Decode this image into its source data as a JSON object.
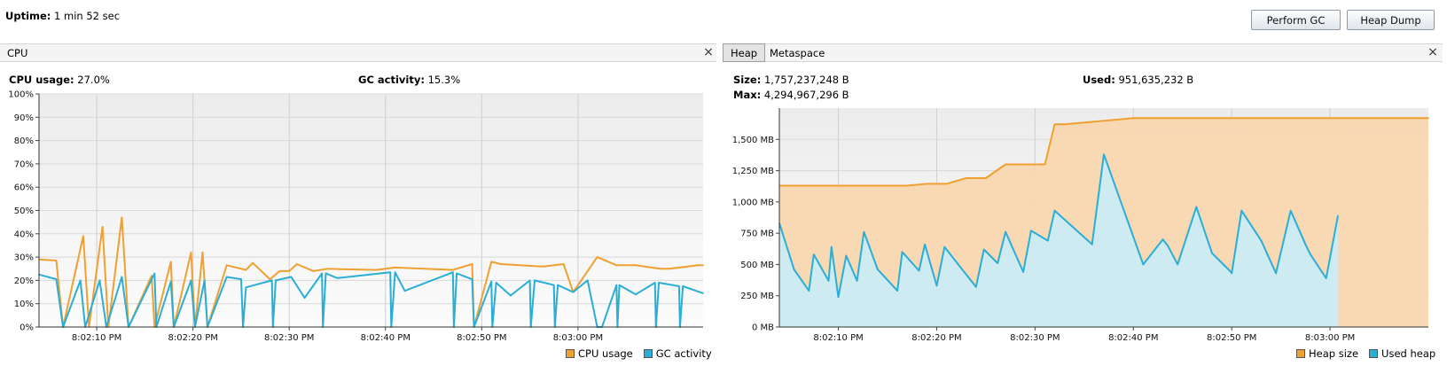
{
  "header": {
    "uptime_label": "Uptime:",
    "uptime_value": "1 min 52 sec",
    "perform_gc_label": "Perform GC",
    "heap_dump_label": "Heap Dump"
  },
  "cpu_panel": {
    "tab_label": "CPU",
    "close_glyph": "×",
    "cpu_usage_label": "CPU usage:",
    "cpu_usage_value": "27.0%",
    "gc_activity_label": "GC activity:",
    "gc_activity_value": "15.3%",
    "legend": [
      "CPU usage",
      "GC activity"
    ]
  },
  "heap_panel": {
    "tabs": [
      "Heap",
      "Metaspace"
    ],
    "active_tab": "Heap",
    "close_glyph": "×",
    "size_label": "Size:",
    "size_value": "1,757,237,248 B",
    "used_label": "Used:",
    "used_value": "951,635,232 B",
    "max_label": "Max:",
    "max_value": "4,294,967,296 B",
    "legend": [
      "Heap size",
      "Used heap"
    ]
  },
  "colors": {
    "orange": "#f0a030",
    "blue": "#2aaed6",
    "heap_fill": "#f8d7b0",
    "used_fill": "#c9ecf8"
  },
  "chart_data": [
    {
      "type": "line",
      "name": "cpu",
      "ylim": [
        0,
        100
      ],
      "yticks": [
        "0%",
        "10%",
        "20%",
        "30%",
        "40%",
        "50%",
        "60%",
        "70%",
        "80%",
        "90%",
        "100%"
      ],
      "xlim": [
        4,
        115
      ],
      "xticks": [
        {
          "t": 10,
          "label": "8:02:10 PM"
        },
        {
          "t": 20,
          "label": "8:02:20 PM"
        },
        {
          "t": 30,
          "label": "8:02:30 PM"
        },
        {
          "t": 40,
          "label": "8:02:40 PM"
        },
        {
          "t": 50,
          "label": "8:02:50 PM"
        },
        {
          "t": 60,
          "label": "8:03:00 PM"
        }
      ],
      "grid": true,
      "legend_position": "bottom-right",
      "series": [
        {
          "name": "CPU usage",
          "color": "#f0a030",
          "points": [
            [
              4,
              29
            ],
            [
              5.8,
              28.5
            ],
            [
              6.5,
              0
            ],
            [
              8.6,
              39
            ],
            [
              9.2,
              0
            ],
            [
              10.6,
              43
            ],
            [
              11.2,
              0
            ],
            [
              12.6,
              47
            ],
            [
              13.3,
              0
            ],
            [
              15.7,
              22
            ],
            [
              16,
              0
            ],
            [
              17.7,
              28
            ],
            [
              18,
              0
            ],
            [
              19.8,
              32
            ],
            [
              20.2,
              0
            ],
            [
              21,
              32
            ],
            [
              21.5,
              0
            ],
            [
              23.5,
              26.5
            ],
            [
              25.5,
              24.5
            ],
            [
              26.2,
              27.5
            ],
            [
              28,
              20.5
            ],
            [
              29,
              24
            ],
            [
              30,
              24
            ],
            [
              30.8,
              27
            ],
            [
              32.5,
              24
            ],
            [
              34,
              25
            ],
            [
              39,
              24.5
            ],
            [
              41,
              25.5
            ],
            [
              47,
              24.5
            ],
            [
              49,
              27
            ],
            [
              49.2,
              0
            ],
            [
              51,
              28
            ],
            [
              52,
              27
            ],
            [
              56,
              26
            ],
            [
              56.5,
              26
            ],
            [
              58.5,
              27
            ],
            [
              59.5,
              15
            ],
            [
              62,
              30
            ],
            [
              64,
              26.5
            ],
            [
              66,
              26.5
            ],
            [
              68.5,
              25
            ],
            [
              69.5,
              25
            ],
            [
              72.5,
              26.5
            ],
            [
              73,
              26.5
            ]
          ]
        },
        {
          "name": "GC activity",
          "color": "#2aaed6",
          "points": [
            [
              4,
              22.5
            ],
            [
              5.8,
              20.5
            ],
            [
              6.5,
              0
            ],
            [
              8.3,
              20
            ],
            [
              8.8,
              0
            ],
            [
              10.3,
              20
            ],
            [
              11,
              0
            ],
            [
              12.6,
              21.5
            ],
            [
              13.3,
              0
            ],
            [
              16,
              23
            ],
            [
              16.2,
              0
            ],
            [
              17.7,
              19.5
            ],
            [
              18,
              0
            ],
            [
              19.8,
              20
            ],
            [
              20.2,
              0
            ],
            [
              21.2,
              20
            ],
            [
              21.5,
              0
            ],
            [
              23.5,
              21.5
            ],
            [
              25,
              20.5
            ],
            [
              25.2,
              0
            ],
            [
              25.5,
              17
            ],
            [
              28.2,
              20
            ],
            [
              28.3,
              0
            ],
            [
              28.6,
              20
            ],
            [
              30.2,
              21.5
            ],
            [
              31.6,
              12.5
            ],
            [
              33.4,
              23
            ],
            [
              33.5,
              0
            ],
            [
              33.8,
              23
            ],
            [
              35,
              21
            ],
            [
              40.5,
              23.5
            ],
            [
              40.6,
              0
            ],
            [
              41,
              23.5
            ],
            [
              42,
              15.5
            ],
            [
              47,
              23.5
            ],
            [
              47.1,
              0
            ],
            [
              47.4,
              23
            ],
            [
              49,
              20.5
            ],
            [
              49.2,
              0
            ],
            [
              51,
              19.5
            ],
            [
              51.1,
              0
            ],
            [
              51.5,
              19
            ],
            [
              53,
              13.5
            ],
            [
              55,
              20
            ],
            [
              55.1,
              0
            ],
            [
              55.5,
              20
            ],
            [
              57.5,
              18
            ],
            [
              57.6,
              0
            ],
            [
              57.9,
              18
            ],
            [
              59.5,
              15
            ],
            [
              61,
              20
            ],
            [
              62,
              0
            ],
            [
              62.5,
              0
            ],
            [
              64,
              18
            ],
            [
              64.1,
              0
            ],
            [
              64.3,
              18
            ],
            [
              66,
              14
            ],
            [
              68,
              19
            ],
            [
              68.1,
              0
            ],
            [
              68.4,
              19
            ],
            [
              70.5,
              17.5
            ],
            [
              70.6,
              0
            ],
            [
              70.9,
              17.5
            ],
            [
              73,
              14.5
            ]
          ]
        }
      ]
    },
    {
      "type": "area",
      "name": "heap",
      "ylim": [
        0,
        1750
      ],
      "yunit": "MB",
      "yticks": [
        "0 MB",
        "250 MB",
        "500 MB",
        "750 MB",
        "1,000 MB",
        "1,250 MB",
        "1,500 MB"
      ],
      "xticks": [
        {
          "t": 10,
          "label": "8:02:10 PM"
        },
        {
          "t": 20,
          "label": "8:02:20 PM"
        },
        {
          "t": 30,
          "label": "8:02:30 PM"
        },
        {
          "t": 40,
          "label": "8:02:40 PM"
        },
        {
          "t": 50,
          "label": "8:02:50 PM"
        },
        {
          "t": 60,
          "label": "8:03:00 PM"
        }
      ],
      "grid": true,
      "legend_position": "bottom-right",
      "series": [
        {
          "name": "Heap size",
          "color": "#f0a030",
          "points": [
            [
              4,
              1130
            ],
            [
              7,
              1130
            ],
            [
              17,
              1130
            ],
            [
              19,
              1145
            ],
            [
              21,
              1145
            ],
            [
              23,
              1190
            ],
            [
              25,
              1190
            ],
            [
              27,
              1300
            ],
            [
              31,
              1300
            ],
            [
              32,
              1620
            ],
            [
              33,
              1620
            ],
            [
              40,
              1670
            ],
            [
              70,
              1670
            ]
          ]
        },
        {
          "name": "Used heap",
          "color": "#2aaed6",
          "points": [
            [
              4,
              830
            ],
            [
              5.5,
              460
            ],
            [
              7,
              290
            ],
            [
              7.5,
              580
            ],
            [
              9,
              370
            ],
            [
              9.3,
              640
            ],
            [
              10,
              240
            ],
            [
              10.8,
              570
            ],
            [
              11.9,
              370
            ],
            [
              12.6,
              760
            ],
            [
              14,
              460
            ],
            [
              16,
              290
            ],
            [
              16.5,
              600
            ],
            [
              18.2,
              450
            ],
            [
              18.8,
              660
            ],
            [
              20,
              330
            ],
            [
              20.8,
              640
            ],
            [
              22.5,
              470
            ],
            [
              24,
              320
            ],
            [
              24.8,
              620
            ],
            [
              26.2,
              510
            ],
            [
              27,
              760
            ],
            [
              28.8,
              440
            ],
            [
              29.6,
              770
            ],
            [
              31.3,
              690
            ],
            [
              32,
              930
            ],
            [
              35.8,
              660
            ],
            [
              37,
              1380
            ],
            [
              41,
              500
            ],
            [
              43,
              700
            ],
            [
              43.5,
              650
            ],
            [
              44.5,
              500
            ],
            [
              46.4,
              960
            ],
            [
              48,
              590
            ],
            [
              49.8,
              450
            ],
            [
              50,
              430
            ],
            [
              51,
              930
            ],
            [
              53,
              690
            ],
            [
              54.5,
              430
            ],
            [
              56,
              930
            ],
            [
              57.5,
              660
            ],
            [
              58,
              580
            ],
            [
              59.6,
              390
            ],
            [
              60.8,
              890
            ]
          ]
        }
      ]
    }
  ]
}
